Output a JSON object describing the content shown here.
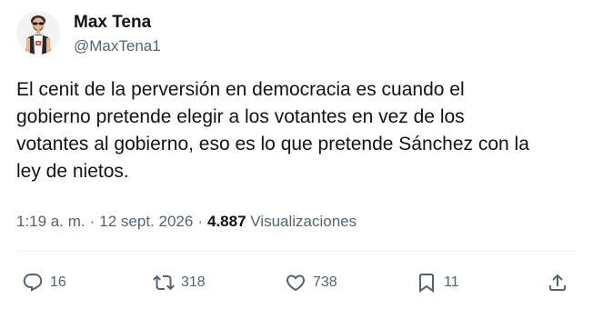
{
  "author": {
    "name": "Max Tena",
    "handle": "@MaxTena1"
  },
  "post": {
    "lines": [
      "El cenit de la perversión en democracia es cuando el",
      "gobierno pretende elegir a los votantes en vez de los",
      "votantes al gobierno, eso es lo que pretende Sánchez con la",
      "ley de nietos."
    ]
  },
  "meta": {
    "time": "1:19 a. m.",
    "separator": "·",
    "date": "12 sept. 2026",
    "views_count": "4.887",
    "views_label": "Visualizaciones"
  },
  "actions": {
    "replies": "16",
    "reposts": "318",
    "likes": "738",
    "bookmarks": "11"
  },
  "icons": {
    "reply": "reply-icon",
    "repost": "repost-icon",
    "like": "heart-icon",
    "bookmark": "bookmark-icon",
    "share": "share-icon"
  },
  "colors": {
    "text_primary": "#0f1419",
    "text_secondary": "#536471",
    "divider": "#eff3f4"
  }
}
